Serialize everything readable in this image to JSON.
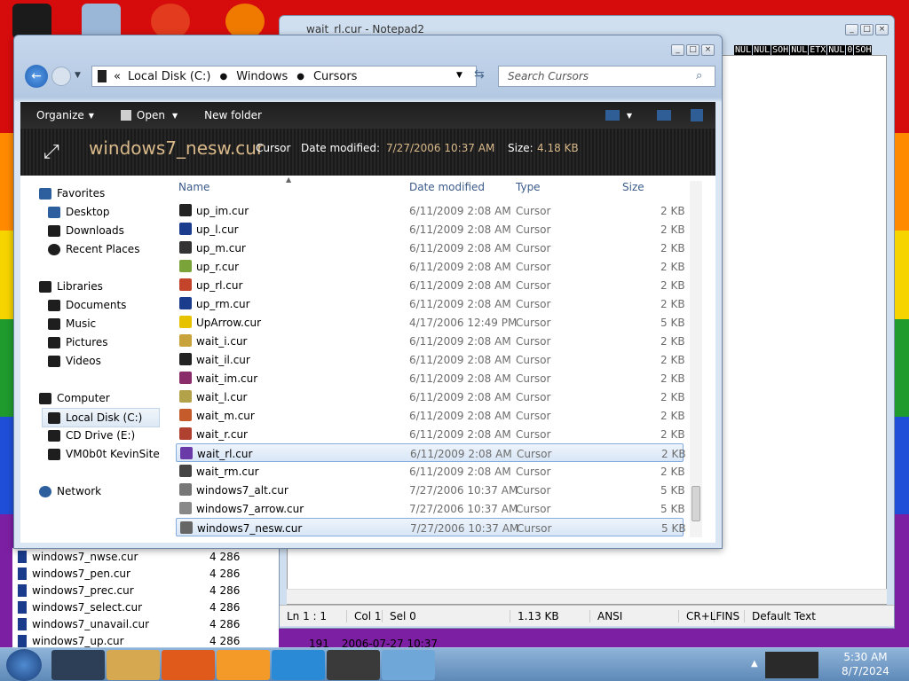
{
  "notepad": {
    "title": "wait_rl.cur - Notepad2",
    "hex": [
      "NUL",
      "NUL",
      "SOH",
      "NUL",
      "ETX",
      "NUL",
      "0",
      "SOH"
    ],
    "status": {
      "pos": "Ln 1 : 1",
      "col": "Col 1",
      "sel": "Sel 0",
      "size": "1.13 KB",
      "encoding": "ANSI",
      "eol": "CR+LF",
      "mode": "INS",
      "scheme": "Default Text"
    }
  },
  "bglist": [
    {
      "name": "windows7_nwse.cur",
      "size": "4 286"
    },
    {
      "name": "windows7_pen.cur",
      "size": "4 286"
    },
    {
      "name": "windows7_prec.cur",
      "size": "4 286"
    },
    {
      "name": "windows7_select.cur",
      "size": "4 286"
    },
    {
      "name": "windows7_unavail.cur",
      "size": "4 286"
    },
    {
      "name": "windows7_up.cur",
      "size": "4 286"
    }
  ],
  "bglist_extra": {
    "num": "191",
    "date": "2006-07-27 10:37"
  },
  "explorer": {
    "address": [
      "Local Disk (C:)",
      "Windows",
      "Cursors"
    ],
    "search_placeholder": "Search Cursors",
    "toolbar": {
      "organize": "Organize",
      "open": "Open",
      "new_folder": "New folder"
    },
    "detail": {
      "name": "windows7_nesw.cur",
      "type": "Cursor",
      "modified_label": "Date modified:",
      "modified": "7/27/2006 10:37 AM",
      "size_label": "Size:",
      "size": "4.18 KB"
    },
    "nav": {
      "favorites": "Favorites",
      "desktop": "Desktop",
      "downloads": "Downloads",
      "recent": "Recent Places",
      "libraries": "Libraries",
      "documents": "Documents",
      "music": "Music",
      "pictures": "Pictures",
      "videos": "Videos",
      "computer": "Computer",
      "local_disk": "Local Disk (C:)",
      "cd_drive": "CD Drive (E:)",
      "vm": "VM0b0t KevinSite",
      "network": "Network"
    },
    "columns": {
      "name": "Name",
      "date": "Date modified",
      "type": "Type",
      "size": "Size"
    },
    "files": [
      {
        "name": "up_im.cur",
        "date": "6/11/2009 2:08 AM",
        "type": "Cursor",
        "size": "2 KB"
      },
      {
        "name": "up_l.cur",
        "date": "6/11/2009 2:08 AM",
        "type": "Cursor",
        "size": "2 KB"
      },
      {
        "name": "up_m.cur",
        "date": "6/11/2009 2:08 AM",
        "type": "Cursor",
        "size": "2 KB"
      },
      {
        "name": "up_r.cur",
        "date": "6/11/2009 2:08 AM",
        "type": "Cursor",
        "size": "2 KB"
      },
      {
        "name": "up_rl.cur",
        "date": "6/11/2009 2:08 AM",
        "type": "Cursor",
        "size": "2 KB"
      },
      {
        "name": "up_rm.cur",
        "date": "6/11/2009 2:08 AM",
        "type": "Cursor",
        "size": "2 KB"
      },
      {
        "name": "UpArrow.cur",
        "date": "4/17/2006 12:49 PM",
        "type": "Cursor",
        "size": "5 KB"
      },
      {
        "name": "wait_i.cur",
        "date": "6/11/2009 2:08 AM",
        "type": "Cursor",
        "size": "2 KB"
      },
      {
        "name": "wait_il.cur",
        "date": "6/11/2009 2:08 AM",
        "type": "Cursor",
        "size": "2 KB"
      },
      {
        "name": "wait_im.cur",
        "date": "6/11/2009 2:08 AM",
        "type": "Cursor",
        "size": "2 KB"
      },
      {
        "name": "wait_l.cur",
        "date": "6/11/2009 2:08 AM",
        "type": "Cursor",
        "size": "2 KB"
      },
      {
        "name": "wait_m.cur",
        "date": "6/11/2009 2:08 AM",
        "type": "Cursor",
        "size": "2 KB"
      },
      {
        "name": "wait_r.cur",
        "date": "6/11/2009 2:08 AM",
        "type": "Cursor",
        "size": "2 KB"
      },
      {
        "name": "wait_rl.cur",
        "date": "6/11/2009 2:08 AM",
        "type": "Cursor",
        "size": "2 KB"
      },
      {
        "name": "wait_rm.cur",
        "date": "6/11/2009 2:08 AM",
        "type": "Cursor",
        "size": "2 KB"
      },
      {
        "name": "windows7_alt.cur",
        "date": "7/27/2006 10:37 AM",
        "type": "Cursor",
        "size": "5 KB"
      },
      {
        "name": "windows7_arrow.cur",
        "date": "7/27/2006 10:37 AM",
        "type": "Cursor",
        "size": "5 KB"
      },
      {
        "name": "windows7_nesw.cur",
        "date": "7/27/2006 10:37 AM",
        "type": "Cursor",
        "size": "5 KB"
      }
    ]
  },
  "clock": {
    "time": "5:30 AM",
    "date": "8/7/2024"
  }
}
